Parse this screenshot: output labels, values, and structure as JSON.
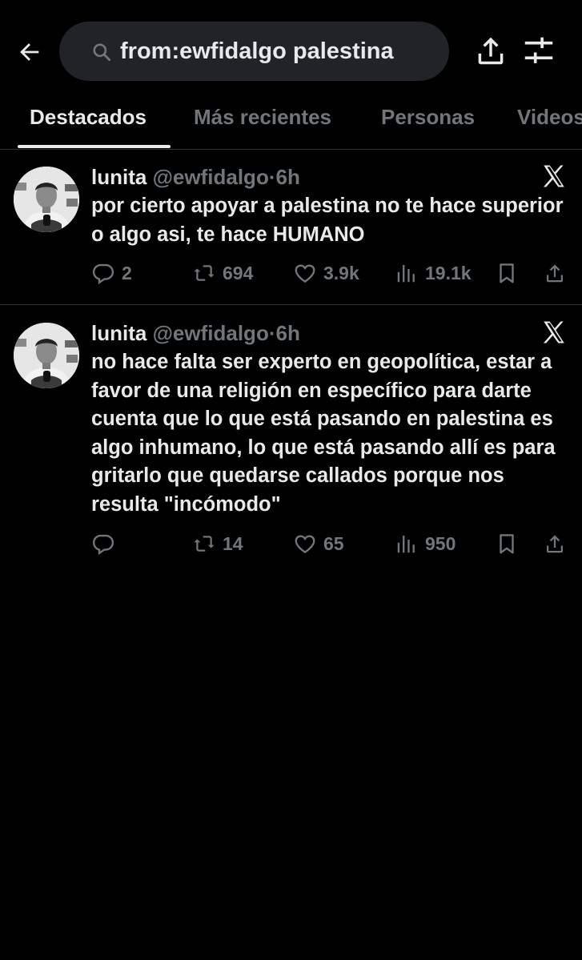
{
  "search": {
    "query": "from:ewfidalgo palestina",
    "icons": {
      "back": "arrow-left-icon",
      "search": "search-icon",
      "share": "share-icon",
      "filter": "filter-sliders-icon"
    }
  },
  "tabs": [
    {
      "label": "Destacados",
      "active": true
    },
    {
      "label": "Más recientes",
      "active": false
    },
    {
      "label": "Personas",
      "active": false
    },
    {
      "label": "Videos",
      "active": false
    }
  ],
  "tweets": [
    {
      "name": "lunita",
      "handle": "@ewfidalgo",
      "separator": "·",
      "time": "6h",
      "text": "por cierto apoyar a palestina no te hace superior o algo asi, te hace HUMANO",
      "replies": "2",
      "retweets": "694",
      "likes": "3.9k",
      "views": "19.1k"
    },
    {
      "name": "lunita",
      "handle": "@ewfidalgo",
      "separator": "·",
      "time": "6h",
      "text": "no hace falta ser experto en geopolítica, estar a favor de una religión en específico para darte cuenta que lo que está pasando en palestina es algo inhumano, lo que está pasando allí es para gritarlo que quedarse callados porque nos resulta \"incómodo\"",
      "replies": "",
      "retweets": "14",
      "likes": "65",
      "views": "950"
    }
  ],
  "colors": {
    "background": "#000000",
    "text": "#e7e9ea",
    "muted": "#71767b",
    "search_bg": "#202327",
    "divider": "#2f3336"
  }
}
